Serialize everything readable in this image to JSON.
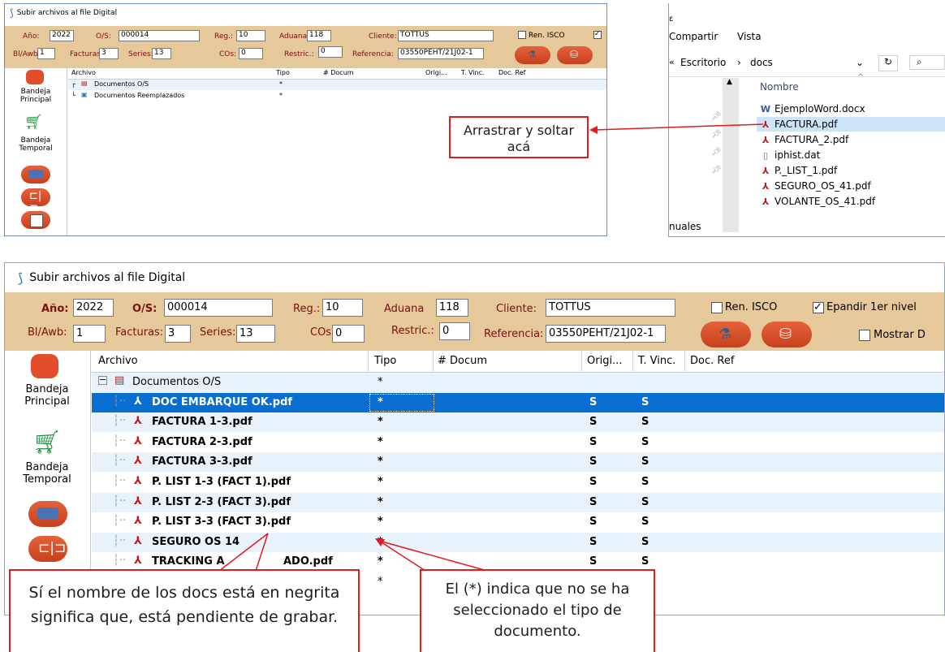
{
  "app": {
    "title": "Subir archivos al file Digital"
  },
  "form": {
    "anio_label": "Año:",
    "anio_value": "2022",
    "os_label": "O/S:",
    "os_value": "000014",
    "reg_label": "Reg.:",
    "reg_value": "10",
    "aduana_label": "Aduana",
    "aduana_value": "118",
    "cliente_label": "Cliente:",
    "cliente_value": "TOTTUS",
    "bl_label": "Bl/Awb:",
    "bl_value": "1",
    "facturas_label": "Facturas:",
    "facturas_value": "3",
    "series_label": "Series:",
    "series_value": "13",
    "cos_label": "COs:",
    "cos_value": "0",
    "restric_label": "Restric.:",
    "restric_value": "0",
    "referencia_label": "Referencia:",
    "referencia_value": "03550PEHT/21J02-1",
    "ren_isco_label": "Ren. ISCO",
    "expandir_label": "Epandir 1er nivel",
    "mostrar_label": "Mostrar D"
  },
  "sidebar": {
    "principal": "Bandeja Principal",
    "temporal": "Bandeja Temporal"
  },
  "grid": {
    "columns": [
      "Archivo",
      "Tipo",
      "# Docum",
      "Origi...",
      "T. Vinc.",
      "Doc. Ref"
    ],
    "top_rows": [
      {
        "name": "Documentos O/S",
        "tipo": "*"
      },
      {
        "name": "Documentos Reemplazados",
        "tipo": "*"
      }
    ],
    "folder": "Documentos O/S",
    "files": [
      {
        "name": "DOC EMBARQUE OK.pdf",
        "tipo": "*",
        "orig": "S",
        "tvinc": "S"
      },
      {
        "name": "FACTURA 1-3.pdf",
        "tipo": "*",
        "orig": "S",
        "tvinc": "S"
      },
      {
        "name": "FACTURA 2-3.pdf",
        "tipo": "*",
        "orig": "S",
        "tvinc": "S"
      },
      {
        "name": "FACTURA 3-3.pdf",
        "tipo": "*",
        "orig": "S",
        "tvinc": "S"
      },
      {
        "name": "P. LIST 1-3 (FACT 1).pdf",
        "tipo": "*",
        "orig": "S",
        "tvinc": "S"
      },
      {
        "name": "P. LIST 2-3 (FACT 3).pdf",
        "tipo": "*",
        "orig": "S",
        "tvinc": "S"
      },
      {
        "name": "P. LIST 3-3 (FACT 3).pdf",
        "tipo": "*",
        "orig": "S",
        "tvinc": "S"
      },
      {
        "name": "SEGURO OS 14",
        "tipo": "*",
        "orig": "S",
        "tvinc": "S"
      },
      {
        "name": "TRACKING A",
        "name_tail": "ADO.pdf",
        "tipo": "*",
        "orig": "S",
        "tvinc": "S"
      }
    ],
    "last_row_tipo": "*"
  },
  "explorer": {
    "menu": [
      "Compartir",
      "Vista"
    ],
    "breadcrumb": [
      "Escritorio",
      "docs"
    ],
    "header": "Nombre",
    "files": [
      {
        "name": "EjemploWord.docx",
        "type": "word-icon"
      },
      {
        "name": "FACTURA.pdf",
        "type": "pdf-icon"
      },
      {
        "name": "FACTURA_2.pdf",
        "type": "pdf-icon"
      },
      {
        "name": "iphist.dat",
        "type": "file-icon"
      },
      {
        "name": "P._LIST_1.pdf",
        "type": "pdf-icon"
      },
      {
        "name": "SEGURO_OS_41.pdf",
        "type": "pdf-icon"
      },
      {
        "name": "VOLANTE_OS_41.pdf",
        "type": "pdf-icon"
      }
    ],
    "side_label": "nuales"
  },
  "callouts": {
    "drag": "Arrastrar y soltar acá",
    "bold": "Sí el nombre de los docs está en negrita significa que, está pendiente de grabar.",
    "asterisk": "El (*) indica que no se ha seleccionado el tipo de documento."
  },
  "colors": {
    "accent_red": "#e21b1b",
    "selection": "#0a6ed1",
    "band": "#e6c99b",
    "row_alt": "#e7f2fb"
  }
}
